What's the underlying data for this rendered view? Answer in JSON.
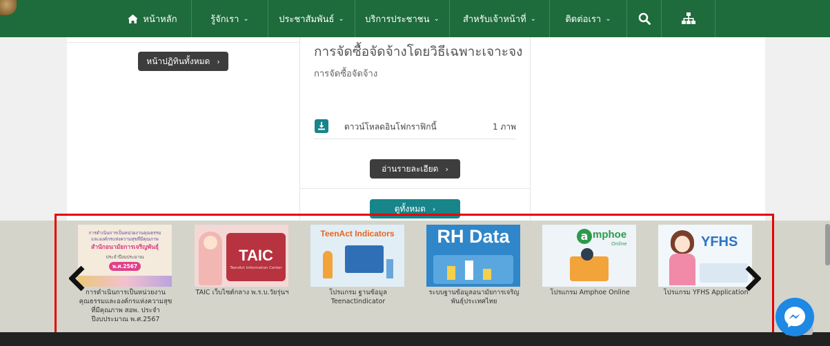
{
  "nav": {
    "items": [
      {
        "label": "หน้าหลัก",
        "icon": "home-icon",
        "has_caret": false
      },
      {
        "label": "รู้จักเรา",
        "has_caret": true
      },
      {
        "label": "ประชาสัมพันธ์",
        "has_caret": true
      },
      {
        "label": "บริการประชาชน",
        "has_caret": true
      },
      {
        "label": "สำหรับเจ้าหน้าที่",
        "has_caret": true
      },
      {
        "label": "ติดต่อเรา",
        "has_caret": true
      }
    ],
    "search_icon": "search-icon",
    "sitemap_icon": "sitemap-icon"
  },
  "left_panel": {
    "all_activities_label": "หน้าปฏิทินทั้งหมด"
  },
  "mid_panel": {
    "title": "การจัดซื้อจัดจ้างโดยวิธีเฉพาะเจาะจง",
    "subtitle": "การจัดซื้อจัดจ้าง",
    "download_label": "ดาวน์โหลดอินโฟกราฟิกนี้",
    "download_count": "1 ภาพ",
    "read_more_label": "อ่านรายละเอียด",
    "view_all_label": "ดูทั้งหมด"
  },
  "carousel": {
    "items": [
      {
        "caption": "การดำเนินการเป็นหน่วยงานคุณธรรมและองค์กรแห่งความสุขที่มีคุณภาพ สอพ. ประจำปีงบประมาณ พ.ศ.2567",
        "thumb_lines": [
          "การดำเนินการเป็นหน่วยงานคุณธรรม",
          "และองค์กรแห่งความสุขที่มีคุณภาพ",
          "สำนักอนามัยการเจริญพันธุ์",
          "ประจำปีงบประมาณ",
          "พ.ศ.2567"
        ]
      },
      {
        "caption": "TAIC เว็บไซต์กลาง พ.ร.บ.วัยรุ่นฯ",
        "thumb_text": "TAIC",
        "thumb_sub": "TeenAct Information Center"
      },
      {
        "caption": "โปรแกรม ฐานข้อมูล Teenactindicator",
        "thumb_text": "TeenAct Indicators"
      },
      {
        "caption": "ระบบฐานข้อมูลอนามัยการเจริญพันธุ์ประเทศไทย",
        "thumb_text": "RH Data"
      },
      {
        "caption": "โปรแกรม Amphoe Online",
        "thumb_text": "mphoe",
        "thumb_sub": "Online"
      },
      {
        "caption": "โปรแกรม YFHS Application",
        "thumb_text": "YFHS"
      }
    ],
    "prev_icon": "chevron-left-icon",
    "next_icon": "chevron-right-icon"
  },
  "colors": {
    "nav_green": "#1e6b3c",
    "teal": "#17858a",
    "dark_button": "#3d3d3d",
    "highlight_red": "#e60000",
    "messenger_blue": "#1e88e5"
  }
}
